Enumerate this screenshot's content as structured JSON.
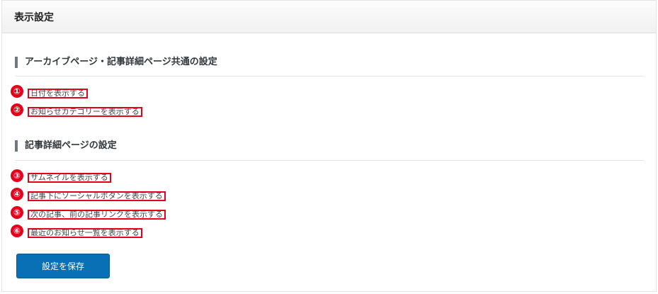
{
  "header": {
    "title": "表示設定"
  },
  "sections": [
    {
      "title": "アーカイブページ・記事詳細ページ共通の設定"
    },
    {
      "title": "記事詳細ページの設定"
    }
  ],
  "options": [
    {
      "badge": "①",
      "label": "日付を表示する"
    },
    {
      "badge": "②",
      "label": "お知らせカテゴリーを表示する"
    },
    {
      "badge": "③",
      "label": "サムネイルを表示する"
    },
    {
      "badge": "④",
      "label": "記事下にソーシャルボタンを表示する"
    },
    {
      "badge": "⑤",
      "label": "次の記事、前の記事リンクを表示する"
    },
    {
      "badge": "⑥",
      "label": "最近のお知らせ一覧を表示する"
    }
  ],
  "save_button": {
    "label": "設定を保存"
  },
  "colors": {
    "badge": "#e3001b",
    "button": "#0a70b5"
  }
}
